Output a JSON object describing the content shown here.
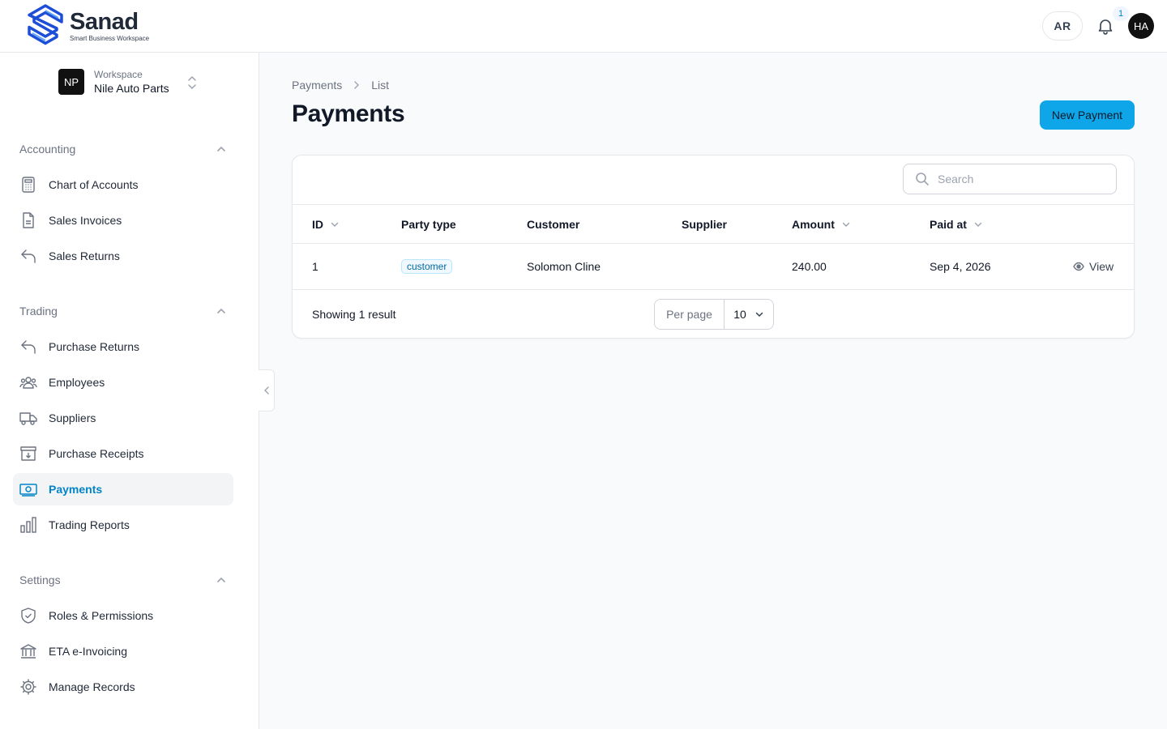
{
  "brand": {
    "name": "Sanad",
    "tagline": "Smart Business Workspace",
    "accent": "#0ea5e9",
    "logo_color": "#2563eb"
  },
  "topbar": {
    "lang_label": "AR",
    "notification_count": "1",
    "avatar_initials": "HA"
  },
  "workspace": {
    "initials": "NP",
    "label": "Workspace",
    "name": "Nile Auto Parts"
  },
  "sidebar": {
    "groups": [
      {
        "label": "Accounting",
        "items": [
          {
            "label": "Chart of Accounts",
            "icon": "calculator-icon"
          },
          {
            "label": "Sales Invoices",
            "icon": "document-icon"
          },
          {
            "label": "Sales Returns",
            "icon": "return-arrow-icon"
          }
        ]
      },
      {
        "label": "Trading",
        "items": [
          {
            "label": "Purchase Returns",
            "icon": "return-arrow-icon"
          },
          {
            "label": "Employees",
            "icon": "users-icon"
          },
          {
            "label": "Suppliers",
            "icon": "truck-icon"
          },
          {
            "label": "Purchase Receipts",
            "icon": "archive-icon"
          },
          {
            "label": "Payments",
            "icon": "banknote-icon",
            "active": true
          },
          {
            "label": "Trading Reports",
            "icon": "bar-chart-icon"
          }
        ]
      },
      {
        "label": "Settings",
        "items": [
          {
            "label": "Roles & Permissions",
            "icon": "shield-check-icon"
          },
          {
            "label": "ETA e-Invoicing",
            "icon": "bank-icon"
          },
          {
            "label": "Manage Records",
            "icon": "gear-icon"
          }
        ]
      }
    ]
  },
  "breadcrumb": {
    "items": [
      "Payments",
      "List"
    ]
  },
  "page": {
    "title": "Payments",
    "new_button": "New Payment"
  },
  "table": {
    "search_placeholder": "Search",
    "columns": [
      "ID",
      "Party type",
      "Customer",
      "Supplier",
      "Amount",
      "Paid at"
    ],
    "rows": [
      {
        "id": "1",
        "party_type": "customer",
        "customer": "Solomon Cline",
        "supplier": "",
        "amount": "240.00",
        "paid_at": "Sep 4, 2026",
        "action": "View"
      }
    ],
    "showing_text": "Showing 1 result",
    "per_page_label": "Per page",
    "per_page_value": "10"
  }
}
